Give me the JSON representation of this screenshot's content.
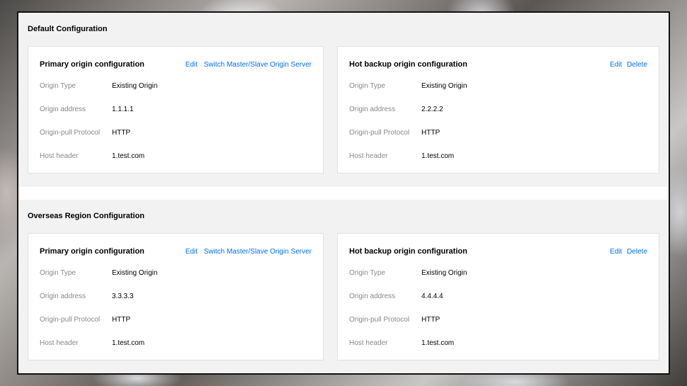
{
  "sections": [
    {
      "title": "Default Configuration",
      "primary": {
        "title": "Primary origin configuration",
        "actions": [
          "Edit",
          "Switch Master/Slave Origin Server"
        ],
        "fields": [
          {
            "label": "Origin Type",
            "value": "Existing Origin"
          },
          {
            "label": "Origin address",
            "value": "1.1.1.1"
          },
          {
            "label": "Origin-pull Protocol",
            "value": "HTTP"
          },
          {
            "label": "Host header",
            "value": "1.test.com"
          }
        ]
      },
      "backup": {
        "title": "Hot backup origin configuration",
        "actions": [
          "Edit",
          "Delete"
        ],
        "fields": [
          {
            "label": "Origin Type",
            "value": "Existing Origin"
          },
          {
            "label": "Origin address",
            "value": "2.2.2.2"
          },
          {
            "label": "Origin-pull Protocol",
            "value": "HTTP"
          },
          {
            "label": "Host header",
            "value": "1.test.com"
          }
        ]
      }
    },
    {
      "title": "Overseas Region Configuration",
      "primary": {
        "title": "Primary origin configuration",
        "actions": [
          "Edit",
          "Switch Master/Slave Origin Server"
        ],
        "fields": [
          {
            "label": "Origin Type",
            "value": "Existing Origin"
          },
          {
            "label": "Origin address",
            "value": "3.3.3.3"
          },
          {
            "label": "Origin-pull Protocol",
            "value": "HTTP"
          },
          {
            "label": "Host header",
            "value": "1.test.com"
          }
        ]
      },
      "backup": {
        "title": "Hot backup origin configuration",
        "actions": [
          "Edit",
          "Delete"
        ],
        "fields": [
          {
            "label": "Origin Type",
            "value": "Existing Origin"
          },
          {
            "label": "Origin address",
            "value": "4.4.4.4"
          },
          {
            "label": "Origin-pull Protocol",
            "value": "HTTP"
          },
          {
            "label": "Host header",
            "value": "1.test.com"
          }
        ]
      }
    }
  ],
  "colors": {
    "link": "#006eff",
    "label": "#888888",
    "section_bg": "#f2f2f2"
  }
}
